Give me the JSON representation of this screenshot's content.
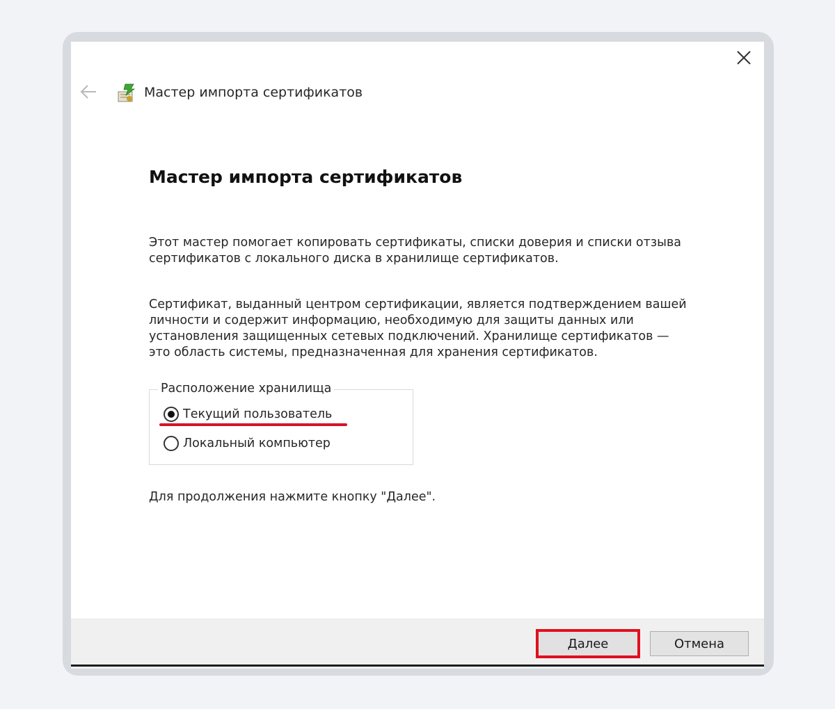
{
  "window": {
    "title": "Мастер импорта сертификатов",
    "close_icon": "close-icon",
    "back_icon": "back-arrow-icon",
    "app_icon": "certificate-wizard-icon"
  },
  "content": {
    "heading": "Мастер импорта сертификатов",
    "paragraph1_line1": "Этот мастер помогает копировать сертификаты, списки доверия и списки отзыва",
    "paragraph1_line2": "сертификатов с локального диска в хранилище сертификатов.",
    "paragraph2_line1": "Сертификат, выданный центром сертификации, является подтверждением вашей",
    "paragraph2_line2": "личности и содержит информацию, необходимую для защиты данных или",
    "paragraph2_line3": "установления защищенных сетевых подключений. Хранилище сертификатов —",
    "paragraph2_line4": "это область системы, предназначенная для хранения сертификатов.",
    "continue_hint": "Для продолжения нажмите кнопку \"Далее\"."
  },
  "store_location": {
    "legend": "Расположение хранилища",
    "options": [
      {
        "label": "Текущий пользователь",
        "checked": true
      },
      {
        "label": "Локальный компьютер",
        "checked": false
      }
    ]
  },
  "footer": {
    "next_label": "Далее",
    "cancel_label": "Отмена"
  },
  "colors": {
    "highlight": "#e0101e",
    "footer_bg": "#f0f0f0"
  }
}
